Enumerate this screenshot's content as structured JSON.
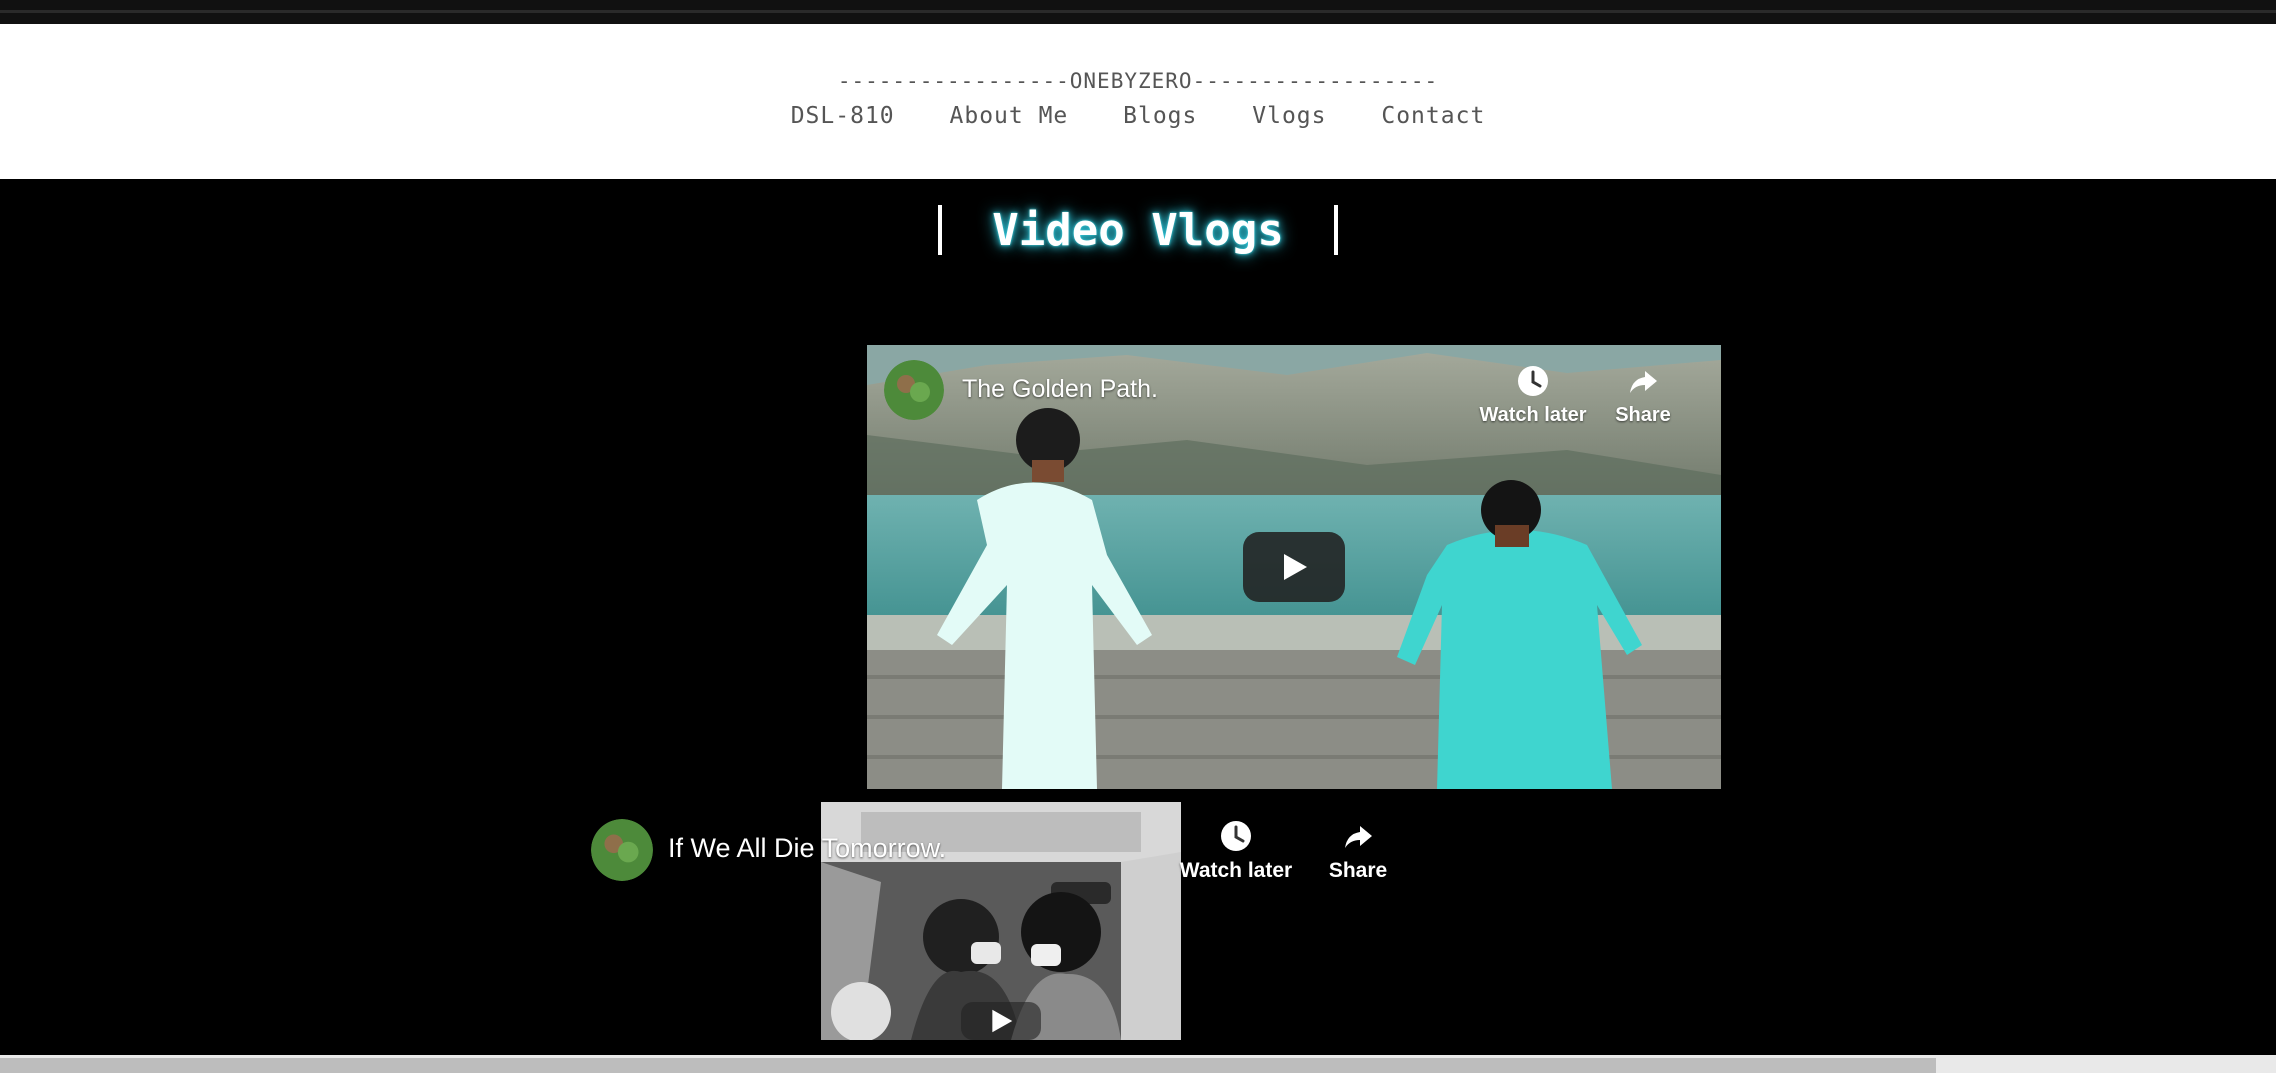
{
  "header": {
    "brand": "-----------------ONEBYZERO------------------",
    "nav": [
      {
        "label": "DSL-810"
      },
      {
        "label": "About Me"
      },
      {
        "label": "Blogs"
      },
      {
        "label": "Vlogs"
      },
      {
        "label": "Contact"
      }
    ]
  },
  "page": {
    "title": "Video Vlogs"
  },
  "videos": [
    {
      "title": "The Golden Path.",
      "watch_later": "Watch later",
      "share": "Share"
    },
    {
      "title": "If We All Die Tomorrow.",
      "watch_later": "Watch later",
      "share": "Share"
    }
  ],
  "icons": {
    "watch_later": "clock-icon",
    "share": "share-arrow-icon",
    "play": "play-icon",
    "channel": "channel-avatar"
  },
  "colors": {
    "page_bg": "#000000",
    "header_bg": "#ffffff",
    "nav_text": "#555555",
    "title_glow": "#2ec4d8",
    "scrollbar_thumb": "#bdbdbd"
  }
}
